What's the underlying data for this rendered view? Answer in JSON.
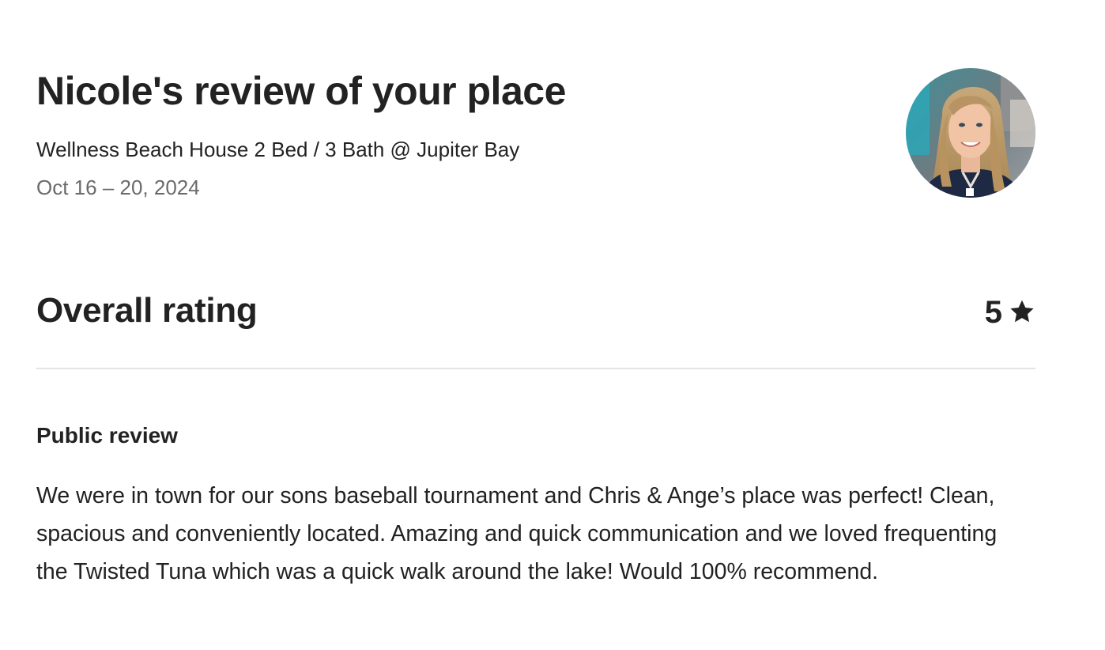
{
  "review": {
    "title": "Nicole's review of your place",
    "listing_name": "Wellness Beach House 2 Bed / 3 Bath @ Jupiter Bay",
    "dates": "Oct 16 – 20, 2024",
    "avatar_icon": "reviewer-avatar-photo"
  },
  "overall": {
    "label": "Overall rating",
    "value": "5",
    "icon": "star-icon"
  },
  "public_review": {
    "heading": "Public review",
    "text": "We were in town for our sons baseball tournament and Chris & Ange’s place was perfect! Clean, spacious and conveniently located. Amazing and quick communication and we loved frequenting the Twisted Tuna which was a quick walk around the lake! Would 100% recommend."
  },
  "colors": {
    "text_primary": "#222222",
    "text_secondary": "#6a6a6a",
    "divider": "#e4e4e4"
  }
}
